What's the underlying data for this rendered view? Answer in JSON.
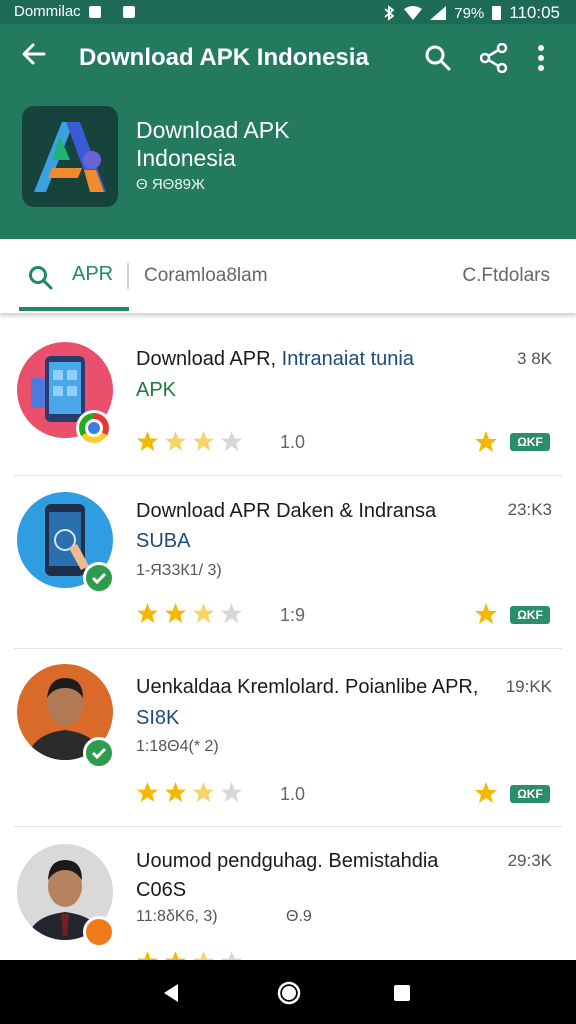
{
  "status_bar": {
    "left_text": "Dommilac",
    "battery": "79%",
    "time": "110:05"
  },
  "app_bar": {
    "title": "Download APK Indonesia"
  },
  "hero": {
    "name_line1": "Download APK",
    "name_line2": "Indonesia",
    "meta": "Θ ЯΘ89Ж"
  },
  "tabs": {
    "active": "APR",
    "second": "Coramloa8lam",
    "third": "C.Ftdolars"
  },
  "items": [
    {
      "name": "Download APR,",
      "name_hl": " Intranaiat tunia",
      "sub": "APK",
      "sub_color": "#1e7b3f",
      "meta": "",
      "size": "3 8K",
      "rating": "1.0",
      "stars": [
        1,
        0.5,
        0.5,
        0
      ],
      "chip": "ΩKF"
    },
    {
      "name": "Download APR Daken & Indransa",
      "name_hl": "",
      "sub": "SUBA",
      "sub_color": "#1d4b78",
      "meta": "1-ЯЗ3К1/ 3)",
      "size": "23:K3",
      "rating": "1:9",
      "stars": [
        1,
        1,
        0.5,
        0
      ],
      "chip": "ΩKF"
    },
    {
      "name": "Uenkaldaa Kremlolard. Poianlibe APR,",
      "name_hl": "",
      "sub": "SI8K",
      "sub_color": "#1d4b78",
      "meta": "1:18Θ4(* 2)",
      "size": "19:KK",
      "rating": "1.0",
      "stars": [
        1,
        1,
        0.5,
        0
      ],
      "chip": "ΩKF"
    },
    {
      "name": "Uoumod pendguhag. Bemistahdia",
      "name_hl": "",
      "sub": "C06S",
      "sub_color": "#1b1b1b",
      "meta": "11:8δK6, 3)",
      "meta2": "Θ.9",
      "size": "29:3K",
      "rating": "",
      "stars": [
        1,
        1,
        0.5,
        0
      ],
      "chip": ""
    }
  ],
  "colors": {
    "primary": "#237a5e",
    "accent": "#1f8a5e",
    "star": "#f5b800"
  },
  "icons": [
    "back-arrow-icon",
    "search-icon",
    "share-icon",
    "more-vert-icon",
    "star-icon",
    "chrome-icon",
    "check-badge-icon"
  ]
}
